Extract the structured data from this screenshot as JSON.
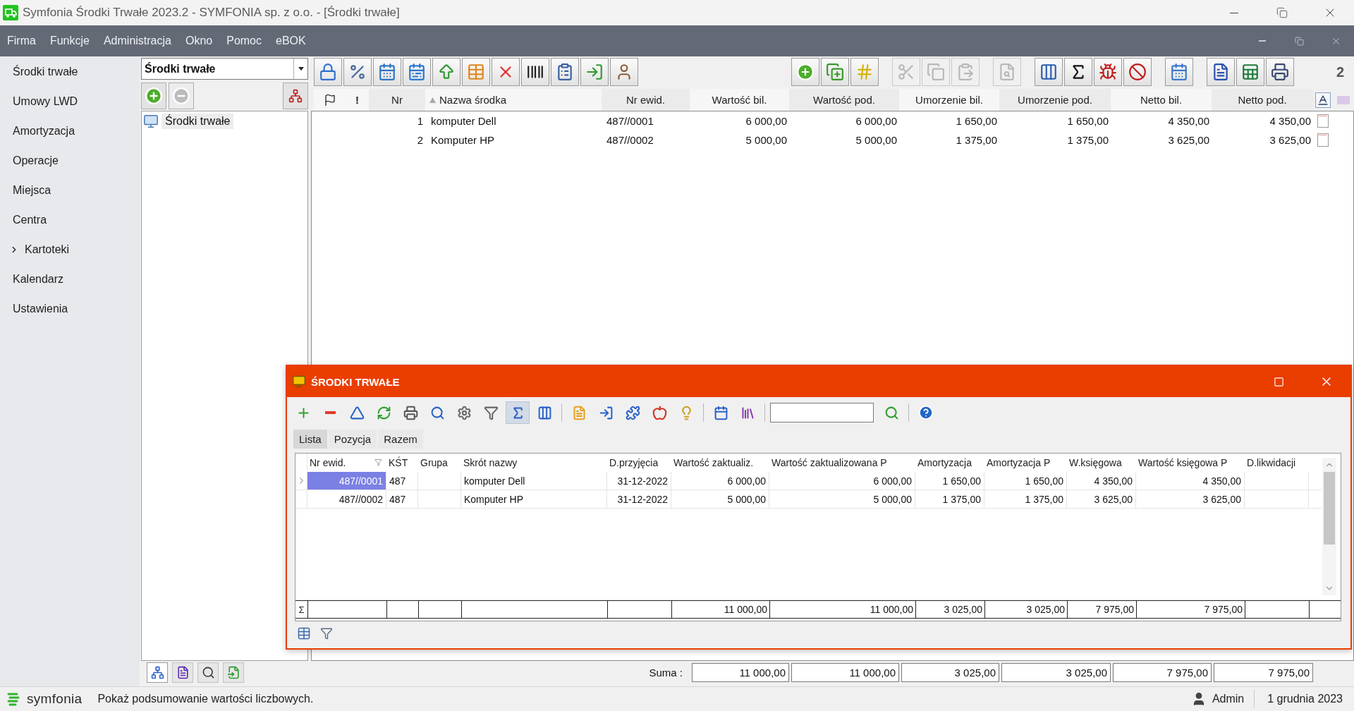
{
  "window": {
    "title": "Symfonia Środki Trwałe 2023.2 - SYMFONIA sp. z o.o. - [Środki trwałe]"
  },
  "menu": [
    "Firma",
    "Funkcje",
    "Administracja",
    "Okno",
    "Pomoc",
    "eBOK"
  ],
  "sidebar": {
    "items": [
      {
        "label": "Środki trwałe",
        "kind": "item"
      },
      {
        "label": "Umowy LWD",
        "kind": "item"
      },
      {
        "label": "Amortyzacja",
        "kind": "item"
      },
      {
        "label": "Operacje",
        "kind": "item"
      },
      {
        "label": "Miejsca",
        "kind": "item"
      },
      {
        "label": "Centra",
        "kind": "item"
      },
      {
        "label": "Kartoteki",
        "kind": "group",
        "expanded": false
      },
      {
        "label": "Kalendarz",
        "kind": "item"
      },
      {
        "label": "Ustawienia",
        "kind": "item"
      }
    ]
  },
  "tree_panel": {
    "selector": {
      "value": "Środki trwałe"
    },
    "buttons": [
      {
        "disabled": false
      },
      {
        "disabled": true
      }
    ],
    "tree": [
      {
        "label": "Środki trwałe",
        "selected": true
      }
    ],
    "view_tabs": [
      {
        "selected": true
      },
      {
        "selected": false
      },
      {
        "selected": false
      },
      {
        "selected": false
      }
    ]
  },
  "toolbar": {
    "groups": [
      [
        {
          "disabled": false
        },
        {
          "disabled": false
        },
        {
          "disabled": false
        },
        {
          "disabled": false
        },
        {
          "disabled": false
        },
        {
          "disabled": false
        },
        {
          "disabled": false
        },
        {
          "disabled": false
        },
        {
          "disabled": false
        },
        {
          "disabled": false
        },
        {
          "disabled": false
        }
      ],
      [
        {
          "disabled": false
        },
        {
          "disabled": false
        },
        {
          "disabled": false
        }
      ],
      [
        {
          "disabled": true
        },
        {
          "disabled": true
        },
        {
          "disabled": true
        }
      ],
      [
        {
          "disabled": true
        }
      ],
      [
        {
          "disabled": false
        },
        {
          "disabled": false
        },
        {
          "disabled": false
        },
        {
          "disabled": false
        }
      ],
      [
        {
          "disabled": false
        }
      ],
      [
        {
          "disabled": false
        },
        {
          "disabled": false
        },
        {
          "disabled": false
        }
      ]
    ],
    "counter": "2"
  },
  "list": {
    "columns": [
      {
        "label": "!",
        "sorted": false
      },
      {
        "label": "Nr",
        "sorted": false
      },
      {
        "label": "Nazwa środka",
        "sorted": true
      },
      {
        "label": "Nr ewid.",
        "sorted": false
      },
      {
        "label": "Wartość bil.",
        "sorted": false,
        "total": "11 000,00"
      },
      {
        "label": "Wartość pod.",
        "sorted": false,
        "total": "11 000,00"
      },
      {
        "label": "Umorzenie bil.",
        "sorted": false,
        "total": "3 025,00"
      },
      {
        "label": "Umorzenie pod.",
        "sorted": false,
        "total": "3 025,00"
      },
      {
        "label": "Netto bil.",
        "sorted": false,
        "total": "7 975,00"
      },
      {
        "label": "Netto pod.",
        "sorted": false,
        "total": "7 975,00"
      }
    ],
    "rows": [
      {
        "nr": "1",
        "name": "komputer Dell",
        "inventory_no": "487//0001",
        "values": [
          "6 000,00",
          "6 000,00",
          "1 650,00",
          "1 650,00",
          "4 350,00",
          "4 350,00"
        ]
      },
      {
        "nr": "2",
        "name": "Komputer HP",
        "inventory_no": "487//0002",
        "values": [
          "5 000,00",
          "5 000,00",
          "1 375,00",
          "1 375,00",
          "3 625,00",
          "3 625,00"
        ]
      }
    ],
    "totals_label": "Suma :"
  },
  "child_window": {
    "title": "ŚRODKI TRWAŁE",
    "toolbar": {
      "groups": [
        [
          {
            "pressed": false
          },
          {
            "pressed": false
          },
          {
            "pressed": false
          },
          {
            "pressed": false
          },
          {
            "pressed": false
          },
          {
            "pressed": false
          },
          {
            "pressed": false
          },
          {
            "pressed": false
          },
          {
            "pressed": true
          },
          {
            "pressed": false
          }
        ],
        [
          {
            "pressed": false
          },
          {
            "pressed": false
          },
          {
            "pressed": false
          },
          {
            "pressed": false
          },
          {
            "pressed": false
          }
        ],
        [
          {
            "pressed": false
          },
          {
            "pressed": false
          }
        ]
      ]
    },
    "tabs": [
      {
        "label": "Lista",
        "selected": true
      },
      {
        "label": "Pozycja",
        "selected": false
      },
      {
        "label": "Razem",
        "selected": false
      }
    ],
    "grid": {
      "columns": [
        {
          "label": "Nr ewid.",
          "filtered": true
        },
        {
          "label": "KŚT",
          "filtered": false
        },
        {
          "label": "Grupa",
          "filtered": false
        },
        {
          "label": "Skrót nazwy",
          "filtered": false
        },
        {
          "label": "D.przyjęcia",
          "filtered": false
        },
        {
          "label": "Wartość zaktualiz.",
          "filtered": false,
          "total": "11 000,00"
        },
        {
          "label": "Wartość zaktualizowana P",
          "filtered": false,
          "total": "11 000,00"
        },
        {
          "label": "Amortyzacja",
          "filtered": false,
          "total": "3 025,00"
        },
        {
          "label": "Amortyzacja P",
          "filtered": false,
          "total": "3 025,00"
        },
        {
          "label": "W.księgowa",
          "filtered": false,
          "total": "7 975,00"
        },
        {
          "label": "Wartość księgowa P",
          "filtered": false,
          "total": "7 975,00"
        },
        {
          "label": "D.likwidacji",
          "filtered": false
        }
      ],
      "rows": [
        {
          "selected": true,
          "inventory_no": "487//0001",
          "cost_center": "487",
          "short_name": "komputer Dell",
          "acquired": "31-12-2022",
          "values": [
            "6 000,00",
            "6 000,00",
            "1 650,00",
            "1 650,00",
            "4 350,00",
            "4 350,00"
          ]
        },
        {
          "selected": false,
          "inventory_no": "487//0002",
          "cost_center": "487",
          "short_name": "Komputer HP",
          "acquired": "31-12-2022",
          "values": [
            "5 000,00",
            "5 000,00",
            "1 375,00",
            "1 375,00",
            "3 625,00",
            "3 625,00"
          ]
        }
      ],
      "totals_marker": "Σ"
    }
  },
  "status_bar": {
    "logo": "symfonia",
    "message": "Pokaż podsumowanie wartości liczbowych.",
    "user": "Admin",
    "date": "1 grudnia 2023"
  }
}
